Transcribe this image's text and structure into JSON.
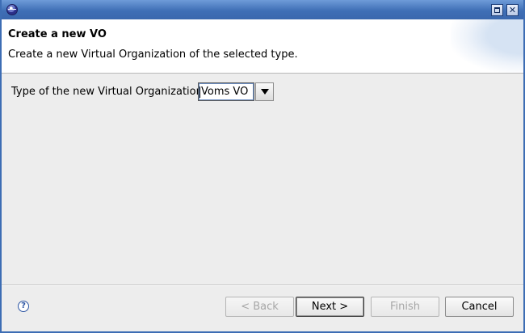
{
  "window": {
    "title": ""
  },
  "header": {
    "title": "Create a new VO",
    "description": "Create a new Virtual Organization of the selected type."
  },
  "form": {
    "type_label": "Type of the new Virtual Organization:",
    "type_value": "Voms VO"
  },
  "buttons": {
    "back_label": "< Back",
    "next_label": "Next >",
    "finish_label": "Finish",
    "cancel_label": "Cancel"
  },
  "icons": {
    "help": "help-icon",
    "app": "eclipse-icon",
    "maximize": "maximize-icon",
    "close": "close-icon"
  }
}
